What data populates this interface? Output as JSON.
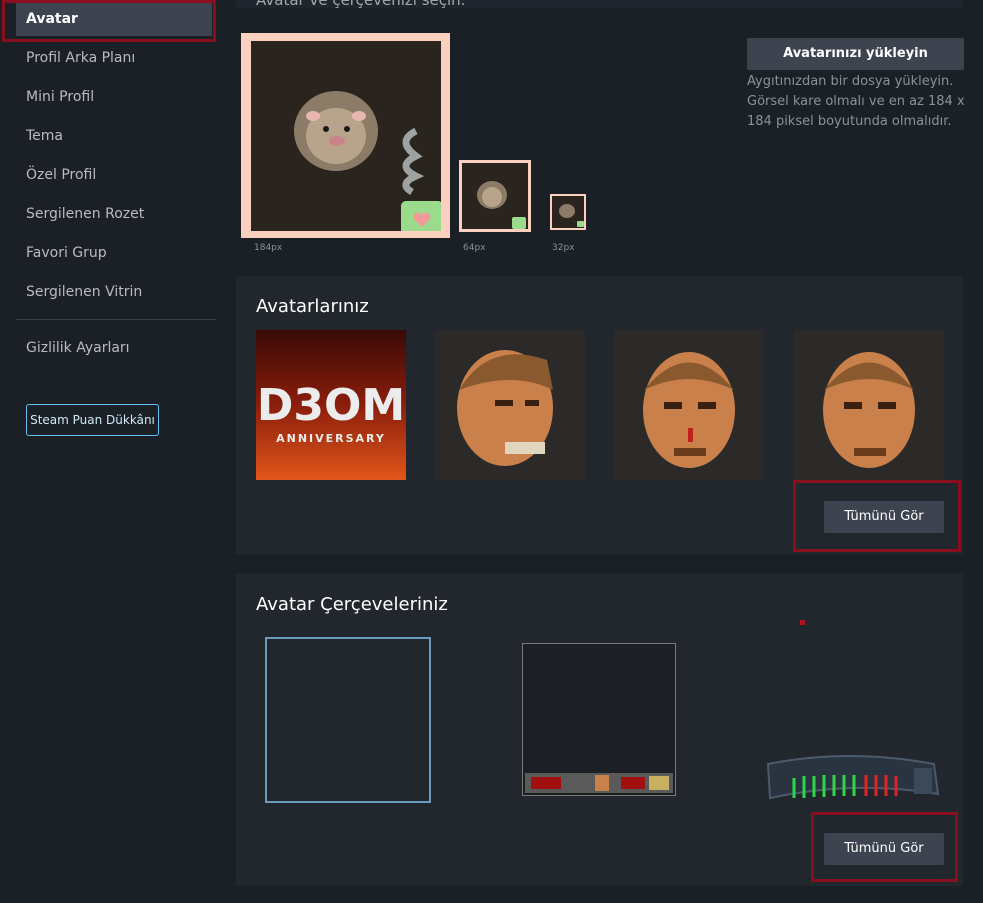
{
  "sidebar": {
    "items": [
      {
        "label": "Avatar",
        "active": true
      },
      {
        "label": "Profil Arka Planı"
      },
      {
        "label": "Mini Profil"
      },
      {
        "label": "Tema"
      },
      {
        "label": "Özel Profil"
      },
      {
        "label": "Sergilenen Rozet"
      },
      {
        "label": "Favori Grup"
      },
      {
        "label": "Sergilenen Vitrin"
      }
    ],
    "privacy": "Gizlilik Ayarları",
    "points_shop": "Steam Puan Dükkânı"
  },
  "header": {
    "subtitle_cut": "Avatar ve çerçevenizi seçin."
  },
  "preview": {
    "sizes": [
      "184px",
      "64px",
      "32px"
    ]
  },
  "upload": {
    "button": "Avatarınızı yükleyin",
    "description": "Aygıtınızdan bir dosya yükleyin. Görsel kare olmalı ve en az 184 x 184 piksel boyutunda olmalıdır."
  },
  "avatars_panel": {
    "title": "Avatarlarınız",
    "doom_logo_text": "D3OM",
    "doom_sub_text": "ANNIVERSARY",
    "see_all": "Tümünü Gör"
  },
  "frames_panel": {
    "title": "Avatar Çerçeveleriniz",
    "see_all": "Tümünü Gör"
  },
  "colors": {
    "accent_red": "#8a0f1c",
    "button": "#3d4450",
    "link_blue": "#67c1f5",
    "preview_border": "#fbd0bf"
  }
}
